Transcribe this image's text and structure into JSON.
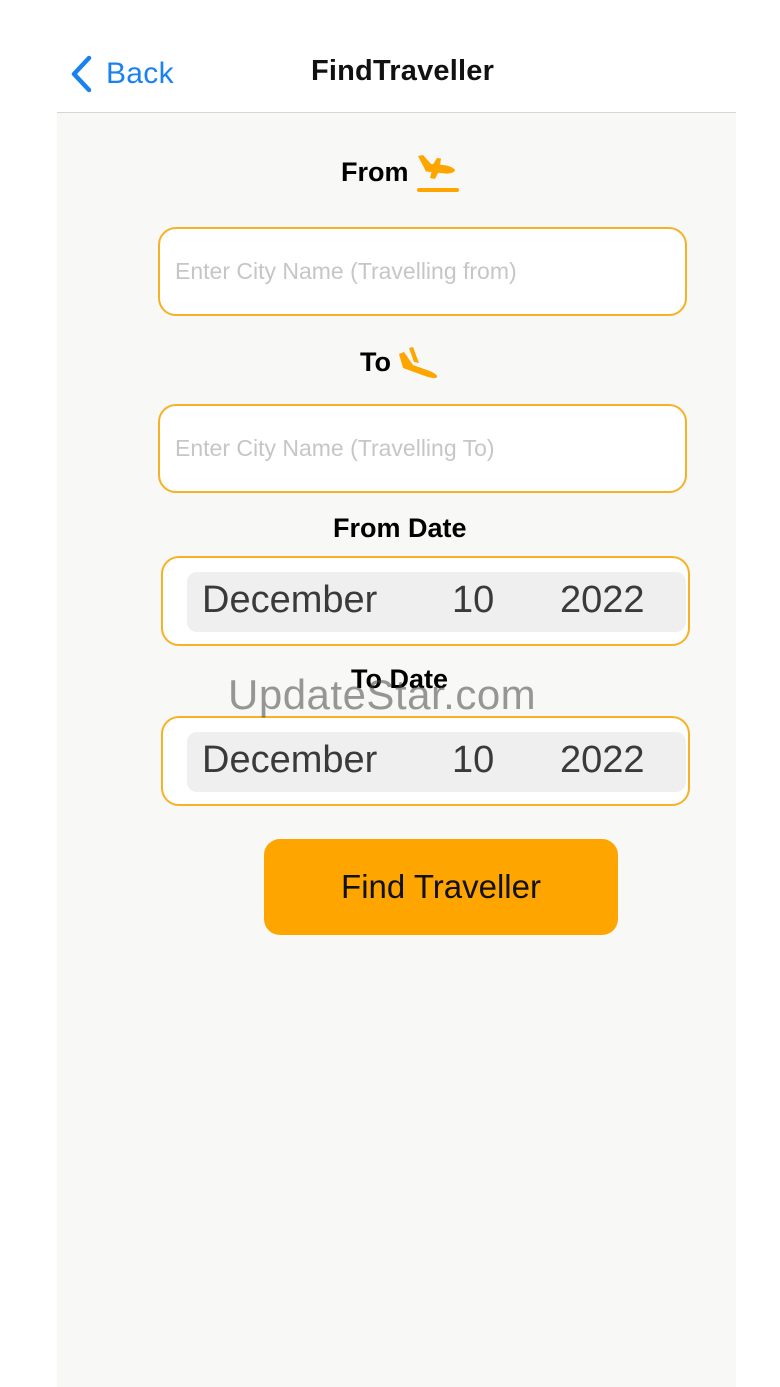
{
  "nav": {
    "back_label": "Back",
    "title": "FindTraveller",
    "back_icon": "chevron-left-icon"
  },
  "form": {
    "from_label": "From",
    "from_icon": "airplane-departure-icon",
    "from_placeholder": "Enter City Name (Travelling from)",
    "from_value": "",
    "to_label": "To",
    "to_icon": "airplane-arrival-icon",
    "to_placeholder": "Enter City Name (Travelling To)",
    "to_value": "",
    "from_date_label": "From Date",
    "from_date": {
      "month": "December",
      "day": "10",
      "year": "2022"
    },
    "to_date_label": "To Date",
    "to_date": {
      "month": "December",
      "day": "10",
      "year": "2022"
    },
    "submit_label": "Find Traveller"
  },
  "watermark": "UpdateStar.com",
  "colors": {
    "accent": "#ffa500",
    "field_border": "#f7b124",
    "link_blue": "#1a82f0",
    "background": "#f8f8f6"
  }
}
